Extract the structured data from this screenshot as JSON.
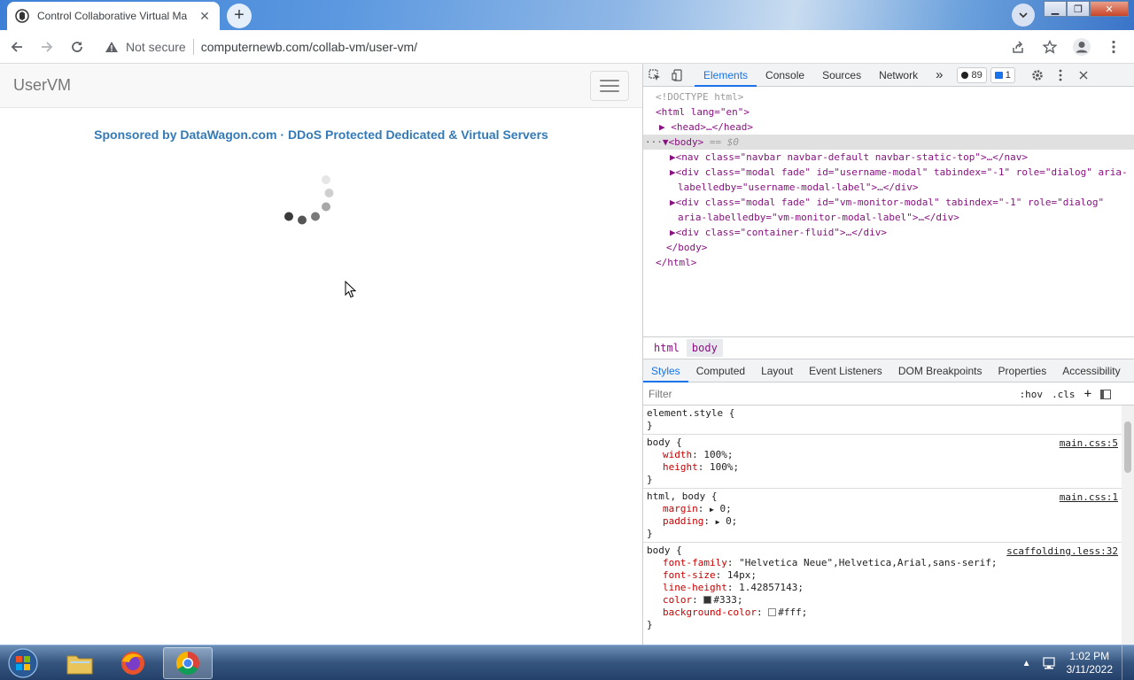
{
  "browser": {
    "tab_title": "Control Collaborative Virtual Ma",
    "new_tab_symbol": "+",
    "security_label": "Not secure",
    "url": "computernewb.com/collab-vm/user-vm/"
  },
  "page": {
    "brand": "UserVM",
    "sponsor": "Sponsored by DataWagon.com · DDoS Protected Dedicated & Virtual Servers"
  },
  "devtools": {
    "tabs": [
      "Elements",
      "Console",
      "Sources",
      "Network"
    ],
    "more": "»",
    "issues_count": "89",
    "messages_count": "1",
    "dom": {
      "doctype": "<!DOCTYPE html>",
      "html_open": "<html lang=\"en\">",
      "head": "<head>…</head>",
      "body_open": "<body>",
      "body_eq": "== $0",
      "nav": "<nav class=\"navbar navbar-default navbar-static-top\">…</nav>",
      "div1_a": "<div class=\"modal fade\" id=\"username-modal\" tabindex=\"-1\" role=\"dialog\" aria-",
      "div1_b": "labelledby=\"username-modal-label\">…</div>",
      "div2_a": "<div class=\"modal fade\" id=\"vm-monitor-modal\" tabindex=\"-1\" role=\"dialog\"",
      "div2_b": "aria-labelledby=\"vm-monitor-modal-label\">…</div>",
      "div3": "<div class=\"container-fluid\">…</div>",
      "body_close": "</body>",
      "html_close": "</html>"
    },
    "breadcrumbs": [
      "html",
      "body"
    ],
    "style_tabs": [
      "Styles",
      "Computed",
      "Layout",
      "Event Listeners",
      "DOM Breakpoints",
      "Properties",
      "Accessibility"
    ],
    "filter_placeholder": "Filter",
    "hov": ":hov",
    "cls": ".cls",
    "rules": {
      "r1_sel": "element.style {",
      "close": "}",
      "r2_sel": "body {",
      "r2_src": "main.css:5",
      "r2_p1": "width",
      "r2_v1": "100%;",
      "r2_p2": "height",
      "r2_v2": "100%;",
      "r3_sel": "html, body {",
      "r3_src": "main.css:1",
      "r3_p1": "margin",
      "r3_v1": "0;",
      "r3_p2": "padding",
      "r3_v2": "0;",
      "r4_sel": "body {",
      "r4_src": "scaffolding.less:32",
      "r4_p1": "font-family",
      "r4_v1": "\"Helvetica Neue\",Helvetica,Arial,sans-serif;",
      "r4_p2": "font-size",
      "r4_v2": "14px;",
      "r4_p3": "line-height",
      "r4_v3": "1.42857143;",
      "r4_p4": "color",
      "r4_v4": "#333;",
      "r4_p5": "background-color",
      "r4_v5": "#fff;"
    }
  },
  "taskbar": {
    "time": "1:02 PM",
    "date": "3/11/2022"
  },
  "colors": {
    "link_blue": "#337ab7",
    "devtools_accent": "#1a73e8",
    "swatch_color": "#333",
    "swatch_bg": "#fff"
  }
}
